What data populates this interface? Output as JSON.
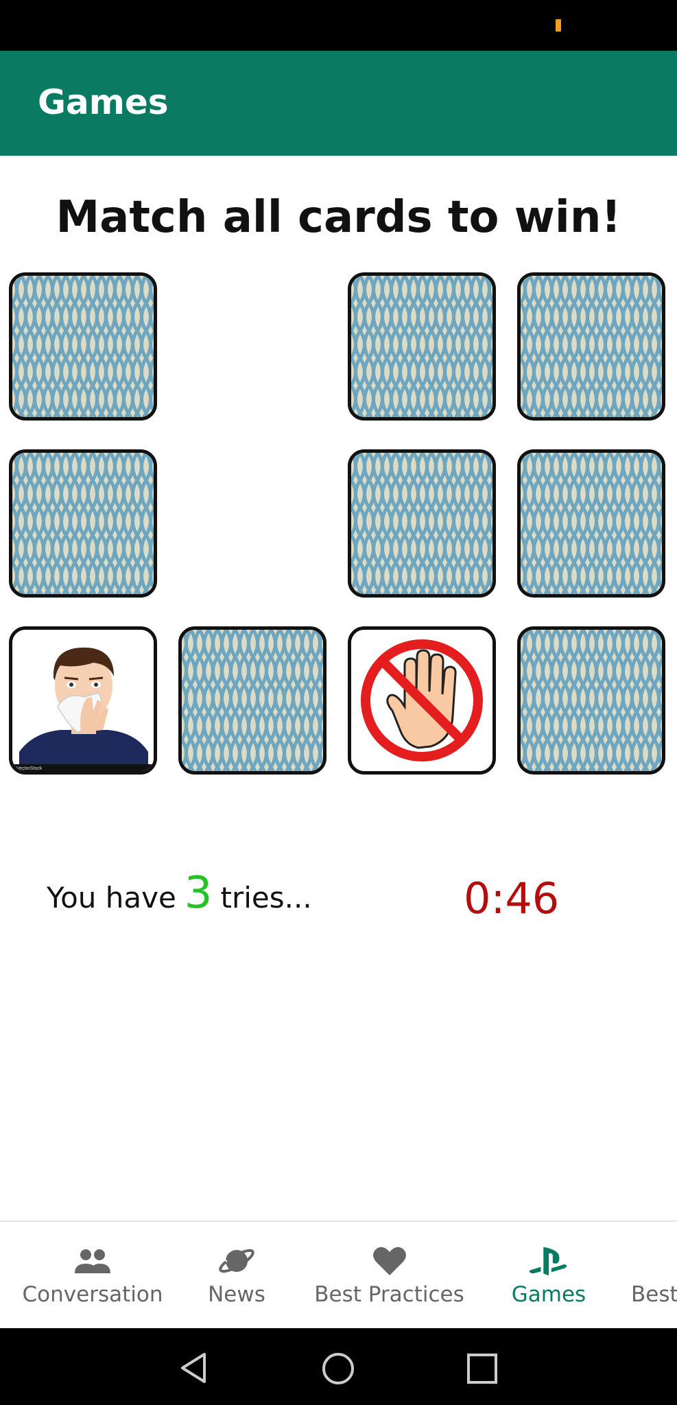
{
  "app_bar": {
    "title": "Games"
  },
  "game": {
    "heading": "Match all cards to win!",
    "tries_prefix": "You have",
    "tries_count": "3",
    "tries_suffix": "tries...",
    "timer": "0:46",
    "cards": [
      {
        "row": 1,
        "col": 1,
        "state": "face-down"
      },
      {
        "row": 1,
        "col": 2,
        "state": "matched-removed"
      },
      {
        "row": 1,
        "col": 3,
        "state": "face-down"
      },
      {
        "row": 1,
        "col": 4,
        "state": "face-down"
      },
      {
        "row": 2,
        "col": 1,
        "state": "face-down"
      },
      {
        "row": 2,
        "col": 2,
        "state": "matched-removed"
      },
      {
        "row": 2,
        "col": 3,
        "state": "face-down"
      },
      {
        "row": 2,
        "col": 4,
        "state": "face-down"
      },
      {
        "row": 3,
        "col": 1,
        "state": "face-up",
        "image": "man-blowing-nose-with-tissue"
      },
      {
        "row": 3,
        "col": 2,
        "state": "face-down"
      },
      {
        "row": 3,
        "col": 3,
        "state": "face-up",
        "image": "no-touching-hand-sign"
      },
      {
        "row": 3,
        "col": 4,
        "state": "face-down"
      }
    ],
    "card_watermark": "VectorStock"
  },
  "bottom_nav": {
    "items": [
      {
        "label": "Conversation",
        "icon": "people-icon",
        "active": false
      },
      {
        "label": "News",
        "icon": "planet-icon",
        "active": false
      },
      {
        "label": "Best Practices",
        "icon": "heart-icon",
        "active": false
      },
      {
        "label": "Games",
        "icon": "gamepad-logo-icon",
        "active": true
      },
      {
        "label": "Best",
        "icon": "",
        "active": false
      }
    ]
  },
  "colors": {
    "app_bar": "#0b7a62",
    "active_nav": "#0b7a62",
    "tries_count": "#22c322",
    "timer": "#b50d0d",
    "card_back_pattern": "#6ea5bf",
    "card_back_base": "#dcdcc6"
  }
}
